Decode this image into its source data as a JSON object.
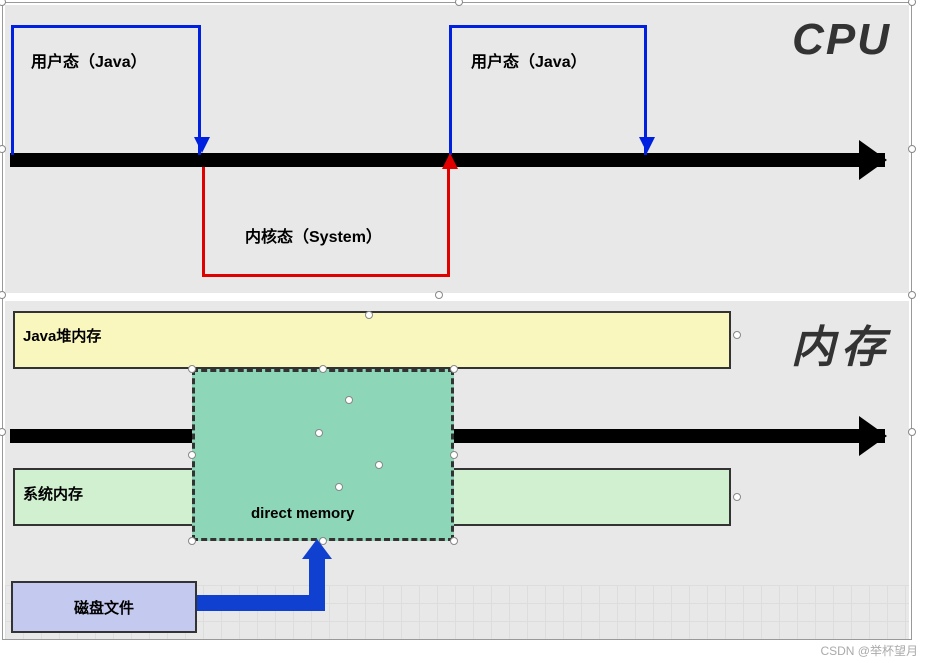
{
  "cpu": {
    "title": "CPU",
    "user_mode_label_1": "用户态（Java）",
    "user_mode_label_2": "用户态（Java）",
    "kernel_mode_label": "内核态（System）"
  },
  "memory": {
    "title": "内存",
    "java_heap_label": "Java堆内存",
    "system_memory_label": "系统内存",
    "direct_memory_label": "direct memory",
    "disk_file_label": "磁盘文件"
  },
  "watermark": "CSDN @举杯望月"
}
